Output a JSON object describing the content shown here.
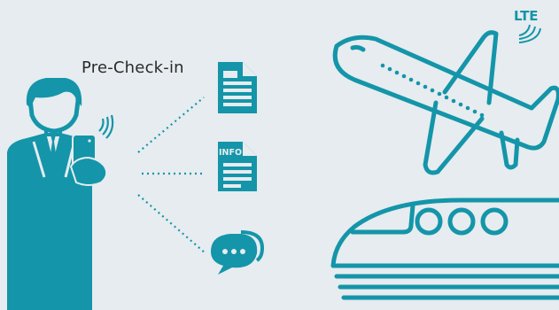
{
  "caption": "Pre-Check-in",
  "network_badge": "LTE",
  "doc_info_label": "INFO",
  "colors": {
    "background": "#e6ecef",
    "accent": "#1495a9",
    "text": "#2a2a2a"
  },
  "icons": [
    "person-with-phone-icon",
    "document-icon",
    "info-document-icon",
    "chat-bubble-icon",
    "airplane-icon",
    "high-speed-train-icon",
    "lte-signal-icon"
  ]
}
